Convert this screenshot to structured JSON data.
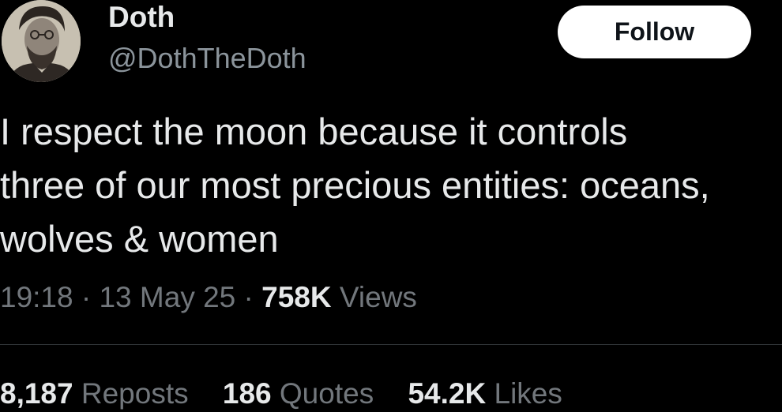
{
  "author": {
    "display_name": "Doth",
    "handle": "@DothTheDoth",
    "avatar_icon": "portrait-avatar-icon"
  },
  "follow_button": {
    "label": "Follow"
  },
  "tweet": {
    "text": "I respect the moon because it controls\nthree of our most precious entities: oceans,\nwolves & women"
  },
  "meta": {
    "time": "19:18",
    "separator": "·",
    "date": "13 May 25",
    "views_count": "758K",
    "views_label": "Views"
  },
  "stats": {
    "reposts_count": "8,187",
    "reposts_label": "Reposts",
    "quotes_count": "186",
    "quotes_label": "Quotes",
    "likes_count": "54.2K",
    "likes_label": "Likes"
  },
  "colors": {
    "background": "#000000",
    "primary_text": "#e7e9ea",
    "secondary_text": "#72777c",
    "button_bg": "#ffffff",
    "divider": "#2f3336"
  }
}
